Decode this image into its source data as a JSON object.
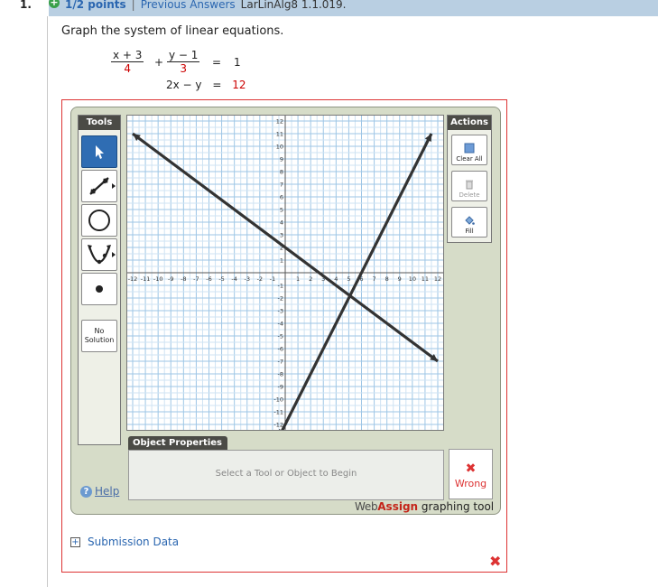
{
  "header": {
    "question_number": "1.",
    "points": "1/2 points",
    "separator": "|",
    "previous_answers": "Previous Answers",
    "question_id": "LarLinAlg8 1.1.019."
  },
  "prompt": "Graph the system of linear equations.",
  "equations": {
    "eq1_num1": "x + 3",
    "eq1_den1": "4",
    "eq1_plus": "+",
    "eq1_num2": "y − 1",
    "eq1_den2": "3",
    "eq1_eq": "=",
    "eq1_rhs": "1",
    "eq2_lhs": "2x − y",
    "eq2_eq": "=",
    "eq2_rhs": "12"
  },
  "tools": {
    "title": "Tools",
    "no_solution": "No Solution",
    "items": [
      "pointer",
      "line",
      "circle",
      "parabola",
      "point"
    ]
  },
  "actions": {
    "title": "Actions",
    "clear_all": "Clear All",
    "delete": "Delete",
    "fill": "Fill"
  },
  "graph": {
    "x_min": -12,
    "x_max": 12,
    "y_min": -12,
    "y_max": 12,
    "grid_minor_step": 0.5,
    "x_tick_labels": [
      "-12",
      "-11",
      "-10",
      "-9",
      "-8",
      "-7",
      "-6",
      "-5",
      "-4",
      "-3",
      "-2",
      "-1",
      "1",
      "2",
      "3",
      "4",
      "5",
      "6",
      "7",
      "8",
      "9",
      "10",
      "11",
      "12"
    ],
    "y_tick_labels": [
      "12",
      "11",
      "10",
      "9",
      "8",
      "7",
      "6",
      "5",
      "4",
      "3",
      "2",
      "1",
      "-1",
      "-2",
      "-3",
      "-4",
      "-5",
      "-6",
      "-7",
      "-8",
      "-9",
      "-10",
      "-11",
      "-12"
    ],
    "lines": [
      {
        "p1": [
          -12,
          11
        ],
        "p2": [
          12,
          -7
        ]
      },
      {
        "p1": [
          -0.5,
          -13
        ],
        "p2": [
          11.5,
          11
        ]
      }
    ],
    "colors": {
      "grid_minor": "#cfe3f3",
      "grid_major": "#9ec6e6",
      "axis": "#555555",
      "line": "#333333"
    }
  },
  "object_properties": {
    "title": "Object Properties",
    "message": "Select a Tool or Object to Begin"
  },
  "result": {
    "icon": "✖",
    "text": "Wrong"
  },
  "help": {
    "icon": "?",
    "label": "Help"
  },
  "brand": {
    "web": "Web",
    "assign": "Assign",
    "rest": " graphing tool"
  },
  "submission": {
    "icon": "+",
    "label": "Submission Data"
  },
  "bottom_mark": "✖"
}
